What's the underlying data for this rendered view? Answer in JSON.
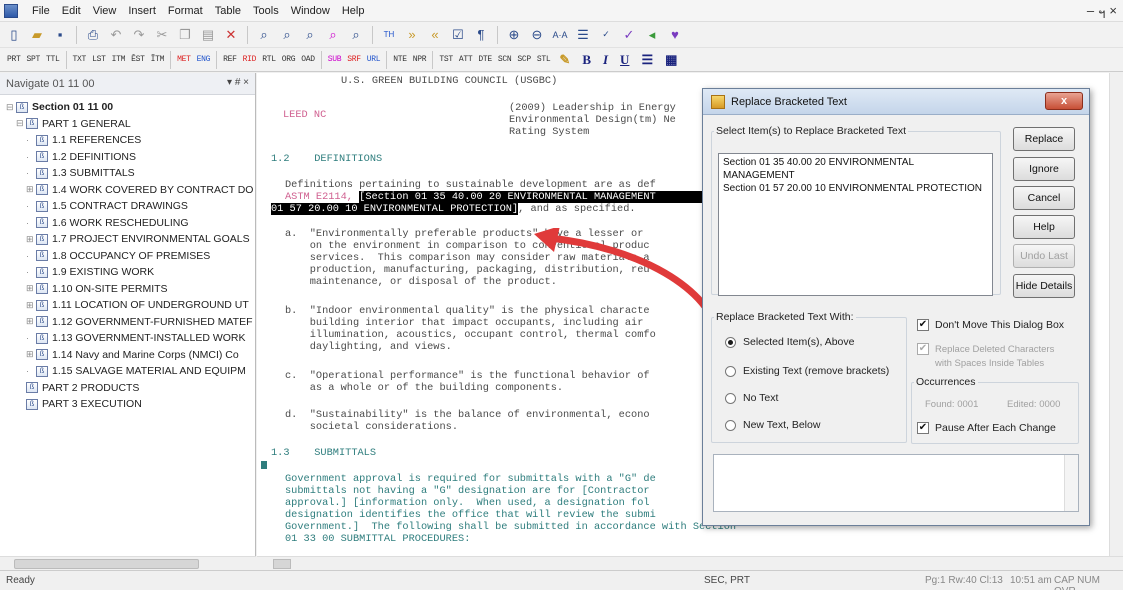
{
  "menu": [
    "File",
    "Edit",
    "View",
    "Insert",
    "Format",
    "Table",
    "Tools",
    "Window",
    "Help"
  ],
  "window_controls": [
    "-",
    "7",
    "×"
  ],
  "toolbar_tags": [
    {
      "t": "PRT",
      "c": ""
    },
    {
      "t": "SPT",
      "c": ""
    },
    {
      "t": "TTL",
      "c": ""
    },
    {
      "t": "TXT",
      "c": ""
    },
    {
      "t": "LST",
      "c": ""
    },
    {
      "t": "ITM",
      "c": ""
    },
    {
      "t": "ÊST",
      "c": ""
    },
    {
      "t": "ĨTM",
      "c": ""
    },
    {
      "t": "MET",
      "c": "red"
    },
    {
      "t": "ENG",
      "c": "blue"
    },
    {
      "t": "REF",
      "c": ""
    },
    {
      "t": "RID",
      "c": "red"
    },
    {
      "t": "RTL",
      "c": ""
    },
    {
      "t": "ORG",
      "c": ""
    },
    {
      "t": "OAD",
      "c": ""
    },
    {
      "t": "SUB",
      "c": "magenta"
    },
    {
      "t": "SRF",
      "c": "red"
    },
    {
      "t": "URL",
      "c": "blue"
    },
    {
      "t": "NTE",
      "c": ""
    },
    {
      "t": "NPR",
      "c": ""
    },
    {
      "t": "TST",
      "c": ""
    },
    {
      "t": "ATT",
      "c": ""
    },
    {
      "t": "DTE",
      "c": ""
    },
    {
      "t": "SCN",
      "c": ""
    },
    {
      "t": "SCP",
      "c": ""
    },
    {
      "t": "STL",
      "c": ""
    }
  ],
  "format_buttons": [
    "B",
    "I",
    "U"
  ],
  "navigator": {
    "title": "Navigate 01 11 00",
    "controls": "▾ # ×",
    "tree": [
      {
        "label": "Section 01 11 00",
        "level": 0,
        "exp": "⊟",
        "root": true
      },
      {
        "label": "PART 1  GENERAL",
        "level": 1,
        "exp": "⊟"
      },
      {
        "label": "1.1  REFERENCES",
        "level": 2,
        "exp": ""
      },
      {
        "label": "1.2  DEFINITIONS",
        "level": 2,
        "exp": ""
      },
      {
        "label": "1.3  SUBMITTALS",
        "level": 2,
        "exp": ""
      },
      {
        "label": "1.4  WORK COVERED BY CONTRACT DO",
        "level": 2,
        "exp": "⊞"
      },
      {
        "label": "1.5  CONTRACT DRAWINGS",
        "level": 2,
        "exp": ""
      },
      {
        "label": "1.6  WORK RESCHEDULING",
        "level": 2,
        "exp": ""
      },
      {
        "label": "1.7  PROJECT ENVIRONMENTAL GOALS",
        "level": 2,
        "exp": "⊞"
      },
      {
        "label": "1.8  OCCUPANCY OF PREMISES",
        "level": 2,
        "exp": ""
      },
      {
        "label": "1.9  EXISTING WORK",
        "level": 2,
        "exp": ""
      },
      {
        "label": "1.10  ON-SITE PERMITS",
        "level": 2,
        "exp": "⊞"
      },
      {
        "label": "1.11  LOCATION OF UNDERGROUND UT",
        "level": 2,
        "exp": "⊞"
      },
      {
        "label": "1.12  GOVERNMENT-FURNISHED MATEF",
        "level": 2,
        "exp": "⊞"
      },
      {
        "label": "1.13  GOVERNMENT-INSTALLED WORK",
        "level": 2,
        "exp": ""
      },
      {
        "label": "1.14  Navy and Marine Corps (NMCI) Co",
        "level": 2,
        "exp": "⊞"
      },
      {
        "label": "1.15  SALVAGE MATERIAL AND EQUIPM",
        "level": 2,
        "exp": ""
      },
      {
        "label": "PART 2  PRODUCTS",
        "level": 1,
        "exp": ""
      },
      {
        "label": "PART 3  EXECUTION",
        "level": 1,
        "exp": ""
      }
    ]
  },
  "document": {
    "usgbc": "U.S. GREEN BUILDING COUNCIL (USGBC)",
    "leed": "LEED NC",
    "leed_desc1": "(2009) Leadership in Energy",
    "leed_desc2": "Environmental Design(tm) Ne",
    "leed_desc3": "Rating System",
    "s12": "1.2    DEFINITIONS",
    "defs_intro": "Definitions pertaining to sustainable development are as def",
    "astm": "ASTM E2114, ",
    "hl1": "[Section 01 35 40.00 20 ENVIRONMENTAL MANAGEMENT",
    "hl2": "01 57 20.00 10 ENVIRONMENTAL PROTECTION]",
    "hl2_tail": ", and as specified.",
    "a1": "a.  \"Environmentally preferable products\" have a lesser or",
    "a2": "    on the environment in comparison to conventional produc",
    "a3": "    services.  This comparison may consider raw materials a",
    "a4": "    production, manufacturing, packaging, distribution, reu",
    "a5": "    maintenance, or disposal of the product.",
    "b1": "b.  \"Indoor environmental quality\" is the physical characte",
    "b2": "    building interior that impact occupants, including air",
    "b3": "    illumination, acoustics, occupant control, thermal comfo",
    "b4": "    daylighting, and views.",
    "c1": "c.  \"Operational performance\" is the functional behavior of",
    "c2": "    as a whole or of the building components.",
    "d1": "d.  \"Sustainability\" is the balance of environmental, econo",
    "d2": "    societal considerations.",
    "s13": "1.3    SUBMITTALS",
    "g1": "Government approval is required for submittals with a \"G\" de",
    "g2": "submittals not having a \"G\" designation are for [Contractor",
    "g3": "approval.] [information only.  When used, a designation fol",
    "g4": "designation identifies the office that will review the submi",
    "g5": "Government.]  The following shall be submitted in accordance with Section",
    "g6": "01 33 00 SUBMITTAL PROCEDURES:"
  },
  "status": {
    "ready": "Ready",
    "sec": "SEC, PRT",
    "pos": "Pg:1  Rw:40 Cl:13",
    "time": "10:51 am",
    "modes": "CAP NUM OVR"
  },
  "dialog": {
    "title": "Replace Bracketed Text",
    "close": "x",
    "select_label": "Select Item(s) to Replace Bracketed Text",
    "items": [
      "Section 01 35 40.00 20 ENVIRONMENTAL MANAGEMENT",
      "Section 01 57 20.00 10 ENVIRONMENTAL PROTECTION"
    ],
    "buttons": {
      "replace": "Replace",
      "ignore": "Ignore",
      "cancel": "Cancel",
      "help": "Help",
      "undo_last": "Undo Last",
      "hide_details": "Hide Details"
    },
    "replace_with_label": "Replace Bracketed Text With:",
    "radios": [
      "Selected Item(s), Above",
      "Existing Text (remove brackets)",
      "No Text",
      "New Text, Below"
    ],
    "dont_move": "Don't Move This Dialog Box",
    "replace_deleted": "Replace Deleted Characters",
    "replace_deleted2": "with Spaces Inside Tables",
    "occurrences_label": "Occurrences",
    "found": "Found: 0001",
    "edited": "Edited: 0000",
    "pause": "Pause After Each Change"
  }
}
